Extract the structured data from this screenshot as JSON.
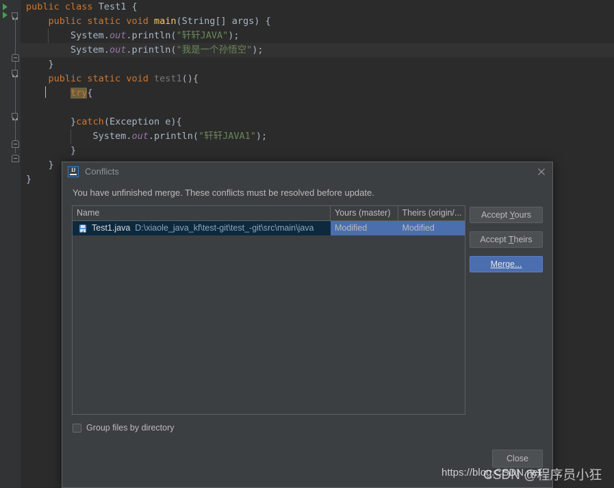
{
  "editor": {
    "language": "java",
    "lines": [
      {
        "indent": 0,
        "tokens": [
          {
            "t": "public ",
            "c": "kw"
          },
          {
            "t": "class ",
            "c": "kw"
          },
          {
            "t": "Test1 {",
            "c": "plain"
          }
        ]
      },
      {
        "indent": 1,
        "tokens": [
          {
            "t": "public ",
            "c": "kw"
          },
          {
            "t": "static ",
            "c": "kw"
          },
          {
            "t": "void ",
            "c": "kw"
          },
          {
            "t": "main",
            "c": "meth"
          },
          {
            "t": "(String[] args) {",
            "c": "plain"
          }
        ]
      },
      {
        "indent": 2,
        "tokens": [
          {
            "t": "System.",
            "c": "plain"
          },
          {
            "t": "out",
            "c": "field"
          },
          {
            "t": ".println(",
            "c": "plain"
          },
          {
            "t": "\"轩轩JAVA\"",
            "c": "str"
          },
          {
            "t": ");",
            "c": "plain"
          }
        ]
      },
      {
        "indent": 2,
        "tokens": [
          {
            "t": "System.",
            "c": "plain"
          },
          {
            "t": "out",
            "c": "field"
          },
          {
            "t": ".println(",
            "c": "plain"
          },
          {
            "t": "\"我是一个孙悟空\"",
            "c": "str"
          },
          {
            "t": ");",
            "c": "plain"
          }
        ]
      },
      {
        "indent": 1,
        "tokens": [
          {
            "t": "}",
            "c": "plain"
          }
        ]
      },
      {
        "indent": 1,
        "tokens": [
          {
            "t": "public ",
            "c": "kw"
          },
          {
            "t": "static ",
            "c": "kw"
          },
          {
            "t": "void ",
            "c": "kw"
          },
          {
            "t": "test1",
            "c": "methg"
          },
          {
            "t": "(){",
            "c": "plain"
          }
        ]
      },
      {
        "indent": 2,
        "tokens": [
          {
            "t": "try",
            "c": "kw-hl"
          },
          {
            "t": "{",
            "c": "plain"
          }
        ]
      },
      {
        "indent": 0,
        "tokens": []
      },
      {
        "indent": 2,
        "tokens": [
          {
            "t": "}",
            "c": "plain"
          },
          {
            "t": "catch",
            "c": "kw"
          },
          {
            "t": "(Exception e){",
            "c": "plain"
          }
        ]
      },
      {
        "indent": 3,
        "tokens": [
          {
            "t": "System.",
            "c": "plain"
          },
          {
            "t": "out",
            "c": "field"
          },
          {
            "t": ".println(",
            "c": "plain"
          },
          {
            "t": "\"轩轩JAVA1\"",
            "c": "str"
          },
          {
            "t": ");",
            "c": "plain"
          }
        ]
      },
      {
        "indent": 2,
        "tokens": [
          {
            "t": "}",
            "c": "plain"
          }
        ]
      },
      {
        "indent": 1,
        "tokens": [
          {
            "t": "}",
            "c": "plain"
          }
        ]
      },
      {
        "indent": 0,
        "tokens": [
          {
            "t": "}",
            "c": "plain"
          }
        ]
      }
    ],
    "current_line_index": 3,
    "colors": {
      "background": "#2b2b2b",
      "gutter": "#313335",
      "current_line": "#323232",
      "keyword": "#cc7832",
      "string": "#6a8759",
      "field": "#9876aa",
      "method": "#ffc66d",
      "default_text": "#a9b7c6"
    }
  },
  "dialog": {
    "title": "Conflicts",
    "app_icon": "IJ",
    "close_icon": "close-icon",
    "message": "You have unfinished merge. These conflicts must be resolved before update.",
    "table": {
      "columns": [
        "Name",
        "Yours (master)",
        "Theirs (origin/..."
      ],
      "rows": [
        {
          "icon": "java-file-icon",
          "file": "Test1.java",
          "path": "D:\\xiaole_java_kf\\test-git\\test_-git\\src\\main\\java",
          "yours": "Modified",
          "theirs": "Modified",
          "selected": true
        }
      ]
    },
    "buttons": {
      "accept_yours": {
        "pre": "Accept ",
        "mnemonic": "Y",
        "post": "ours"
      },
      "accept_theirs": {
        "pre": "Accept ",
        "mnemonic": "T",
        "post": "heirs"
      },
      "merge": {
        "pre": "",
        "mnemonic": "M",
        "post": "erge..."
      },
      "close": "Close"
    },
    "checkbox": {
      "label": "Group files by directory",
      "checked": false
    },
    "colors": {
      "dialog_bg": "#3c3f41",
      "selection": "#4b6eaf",
      "primary_button": "#4b6eaf",
      "border": "#5e6060"
    }
  },
  "watermarks": {
    "url": "https://blog.CSDN.net",
    "author": "CSDN @程序员小狂"
  }
}
